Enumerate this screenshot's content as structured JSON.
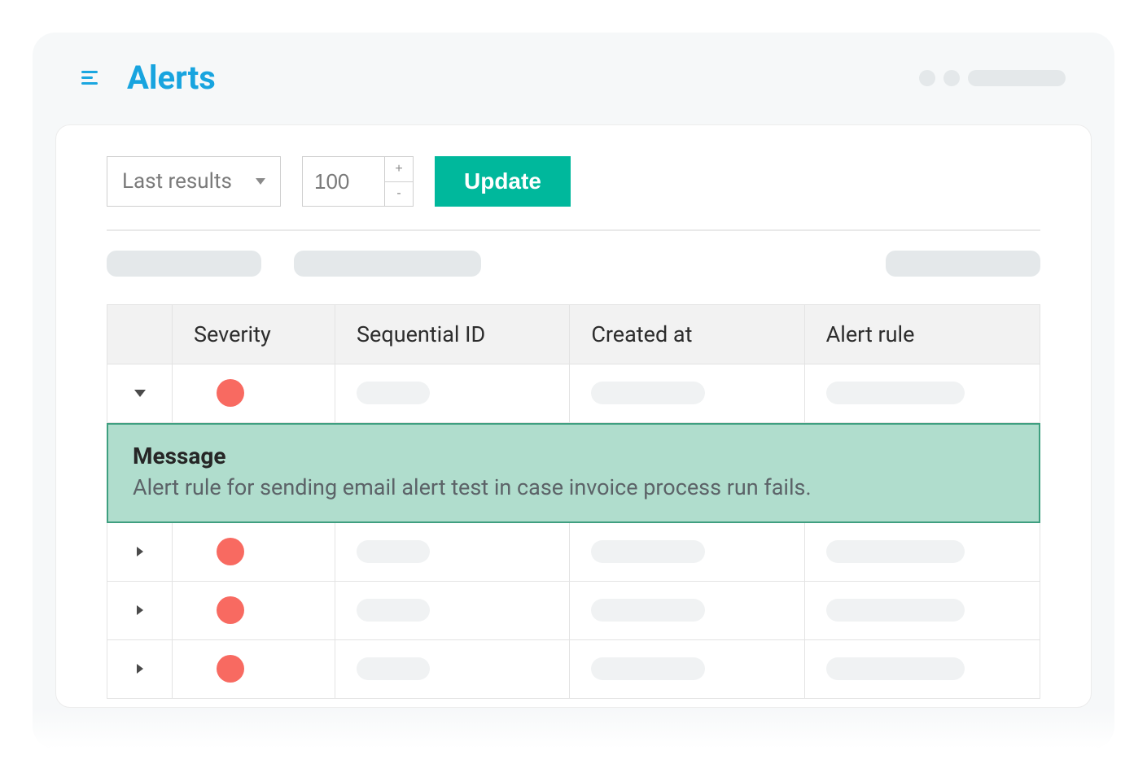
{
  "header": {
    "title": "Alerts"
  },
  "toolbar": {
    "filter_select": "Last results",
    "count_value": "100",
    "update_label": "Update"
  },
  "table": {
    "columns": {
      "severity": "Severity",
      "sequential_id": "Sequential ID",
      "created_at": "Created at",
      "alert_rule": "Alert rule"
    },
    "expanded": {
      "message_label": "Message",
      "message_body": "Alert rule for sending email alert test in case invoice process run fails."
    }
  },
  "colors": {
    "accent": "#18a4df",
    "primary_button": "#00b89c",
    "severity_high": "#f86a61",
    "message_panel_bg": "#b0ddcd",
    "message_panel_border": "#3f9f80"
  }
}
